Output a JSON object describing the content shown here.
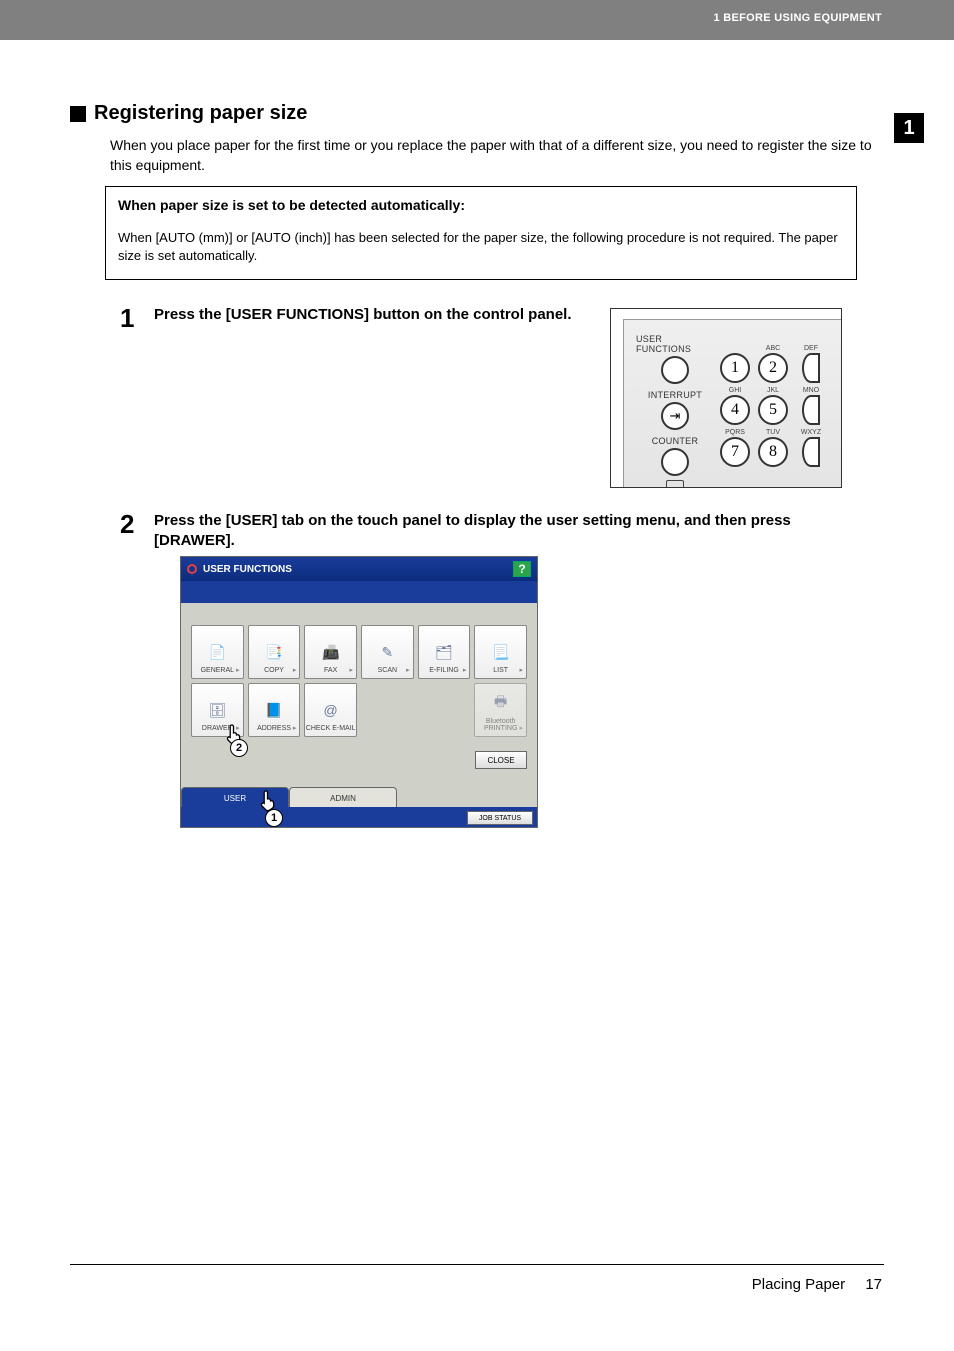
{
  "header": {
    "chapter_label": "1 BEFORE USING EQUIPMENT",
    "chapter_number": "1"
  },
  "section": {
    "title": "Registering paper size",
    "intro": "When you place paper for the first time or you replace the paper with that of a different size, you need to register the size to this equipment."
  },
  "auto_box": {
    "title": "When paper size is set to be detected automatically:",
    "body": "When [AUTO (mm)] or [AUTO (inch)] has been selected for the paper size, the following procedure is not required. The paper size is set automatically."
  },
  "steps": {
    "one": {
      "num": "1",
      "text": "Press the [USER FUNCTIONS] button on the control panel."
    },
    "two": {
      "num": "2",
      "text": "Press the [USER] tab on the touch panel to display the user setting menu, and then press [DRAWER]."
    }
  },
  "control_panel": {
    "labels": {
      "user_functions": "USER FUNCTIONS",
      "interrupt": "INTERRUPT",
      "counter": "COUNTER"
    },
    "key_sub": {
      "abc": "ABC",
      "def": "DEF",
      "ghi": "GHI",
      "jkl": "JKL",
      "mno": "MNO",
      "pqrs": "PQRS",
      "tuv": "TUV",
      "wxyz": "WXYZ"
    },
    "keys": {
      "k1": "1",
      "k2": "2",
      "k4": "4",
      "k5": "5",
      "k7": "7",
      "k8": "8"
    }
  },
  "touch_panel": {
    "title": "USER FUNCTIONS",
    "help": "?",
    "tiles_row1": [
      {
        "label": "GENERAL",
        "icon": "📄"
      },
      {
        "label": "COPY",
        "icon": "📑"
      },
      {
        "label": "FAX",
        "icon": "📠"
      },
      {
        "label": "SCAN",
        "icon": "✎"
      },
      {
        "label": "E-FILING",
        "icon": "🗂"
      },
      {
        "label": "LIST",
        "icon": "📃"
      }
    ],
    "tiles_row2": [
      {
        "label": "DRAWER",
        "icon": "🗄"
      },
      {
        "label": "ADDRESS",
        "icon": "📘"
      },
      {
        "label": "CHECK E-MAIL",
        "icon": "@"
      },
      {
        "label": "",
        "icon": ""
      },
      {
        "label": "",
        "icon": ""
      },
      {
        "label": "Bluetooth PRINTING",
        "icon": "🖶"
      }
    ],
    "close": "CLOSE",
    "tabs": {
      "user": "USER",
      "admin": "ADMIN"
    },
    "job_status": "JOB STATUS"
  },
  "pointers": {
    "p1": "1",
    "p2": "2"
  },
  "footer": {
    "section": "Placing Paper",
    "page": "17"
  }
}
